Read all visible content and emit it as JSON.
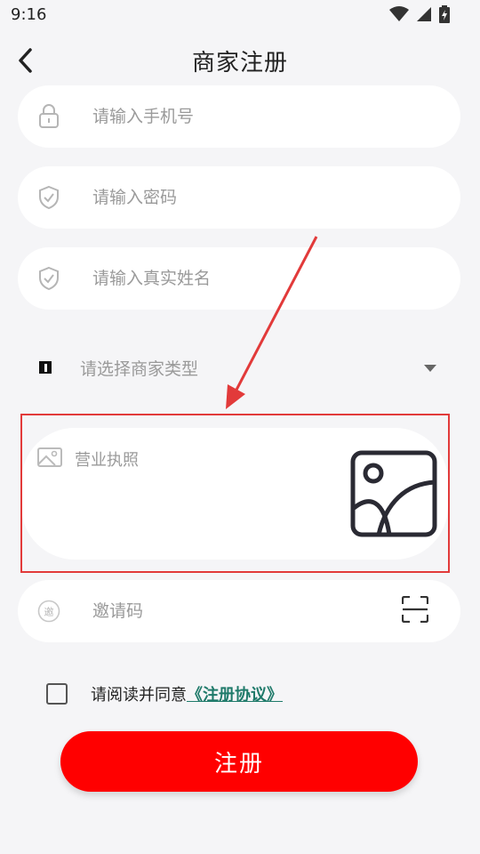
{
  "status_bar": {
    "time": "9:16"
  },
  "header": {
    "title": "商家注册",
    "back_icon": "chevron-left-icon"
  },
  "form": {
    "phone": {
      "placeholder": "请输入手机号",
      "icon": "lock-icon"
    },
    "password": {
      "placeholder": "请输入密码",
      "icon": "shield-check-icon"
    },
    "real_name": {
      "placeholder": "请输入真实姓名",
      "icon": "shield-check-icon"
    },
    "merchant_type": {
      "placeholder": "请选择商家类型",
      "icon": "type-square-icon"
    },
    "business_license": {
      "label": "营业执照",
      "icon": "image-icon"
    },
    "invite_code": {
      "placeholder": "邀请码",
      "icon": "invite-icon",
      "invite_glyph": "邀"
    }
  },
  "agreement": {
    "text": "请阅读并同意",
    "link": "《注册协议》",
    "checked": false
  },
  "submit": {
    "label": "注册"
  },
  "colors": {
    "primary": "#ff0000",
    "link": "#1f7a6a",
    "annotation": "#e23a3a"
  }
}
